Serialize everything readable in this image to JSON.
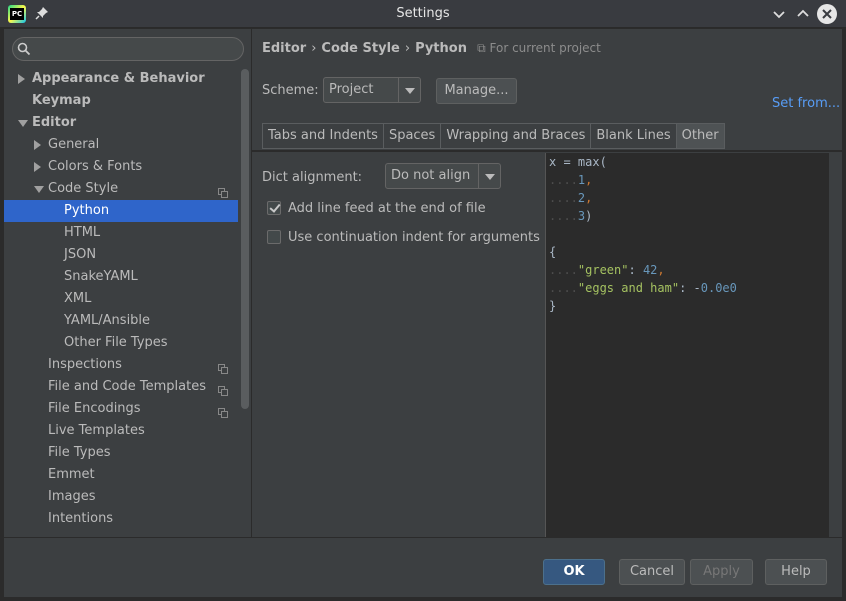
{
  "window": {
    "title": "Settings"
  },
  "search": {
    "placeholder": ""
  },
  "tree": [
    {
      "label": "Appearance & Behavior",
      "bold": true,
      "arrow": "right",
      "indent": 0
    },
    {
      "label": "Keymap",
      "bold": true,
      "arrow": "",
      "indent": 0
    },
    {
      "label": "Editor",
      "bold": true,
      "arrow": "down",
      "indent": 0
    },
    {
      "label": "General",
      "arrow": "right",
      "indent": 1
    },
    {
      "label": "Colors & Fonts",
      "arrow": "right",
      "indent": 1
    },
    {
      "label": "Code Style",
      "arrow": "down",
      "indent": 1,
      "project_icon": true
    },
    {
      "label": "Python",
      "indent": 2,
      "selected": true
    },
    {
      "label": "HTML",
      "indent": 2
    },
    {
      "label": "JSON",
      "indent": 2
    },
    {
      "label": "SnakeYAML",
      "indent": 2
    },
    {
      "label": "XML",
      "indent": 2
    },
    {
      "label": "YAML/Ansible",
      "indent": 2
    },
    {
      "label": "Other File Types",
      "indent": 2
    },
    {
      "label": "Inspections",
      "indent": 1,
      "project_icon": true
    },
    {
      "label": "File and Code Templates",
      "indent": 1,
      "project_icon": true
    },
    {
      "label": "File Encodings",
      "indent": 1,
      "project_icon": true
    },
    {
      "label": "Live Templates",
      "indent": 1
    },
    {
      "label": "File Types",
      "indent": 1
    },
    {
      "label": "Emmet",
      "indent": 1
    },
    {
      "label": "Images",
      "indent": 1
    },
    {
      "label": "Intentions",
      "indent": 1
    }
  ],
  "breadcrumb": {
    "part1": "Editor",
    "part2": "Code Style",
    "part3": "Python",
    "scope": "For current project"
  },
  "scheme": {
    "label": "Scheme:",
    "value": "Project",
    "manage": "Manage...",
    "set_from": "Set from..."
  },
  "tabs": [
    "Tabs and Indents",
    "Spaces",
    "Wrapping and Braces",
    "Blank Lines",
    "Other"
  ],
  "active_tab": "Other",
  "options": {
    "dict_alignment_label": "Dict alignment:",
    "dict_alignment_value": "Do not align",
    "line_feed_label": "Add line feed at the end of file",
    "line_feed_checked": true,
    "continuation_label": "Use continuation indent for arguments",
    "continuation_checked": false
  },
  "preview_code": {
    "l1": "x = max(",
    "l2_dots": "....",
    "l2": "1",
    "l2_end": ",",
    "l3_dots": "....",
    "l3": "2",
    "l3_end": ",",
    "l4_dots": "....",
    "l4": "3",
    "l4_end": ")",
    "l6": "{",
    "l7_dots": "....",
    "l7_key": "\"green\"",
    "l7_colon": ": ",
    "l7_val": "42",
    "l7_end": ",",
    "l8_dots": "....",
    "l8_key": "\"eggs and ham\"",
    "l8_colon": ": ",
    "l8_minus": "-",
    "l8_val": "0.0e0",
    "l9": "}"
  },
  "buttons": {
    "ok": "OK",
    "cancel": "Cancel",
    "apply": "Apply",
    "help": "Help"
  },
  "colors": {
    "selection": "#2f65ca",
    "accent_link": "#589df6",
    "ok_button": "#365880"
  }
}
